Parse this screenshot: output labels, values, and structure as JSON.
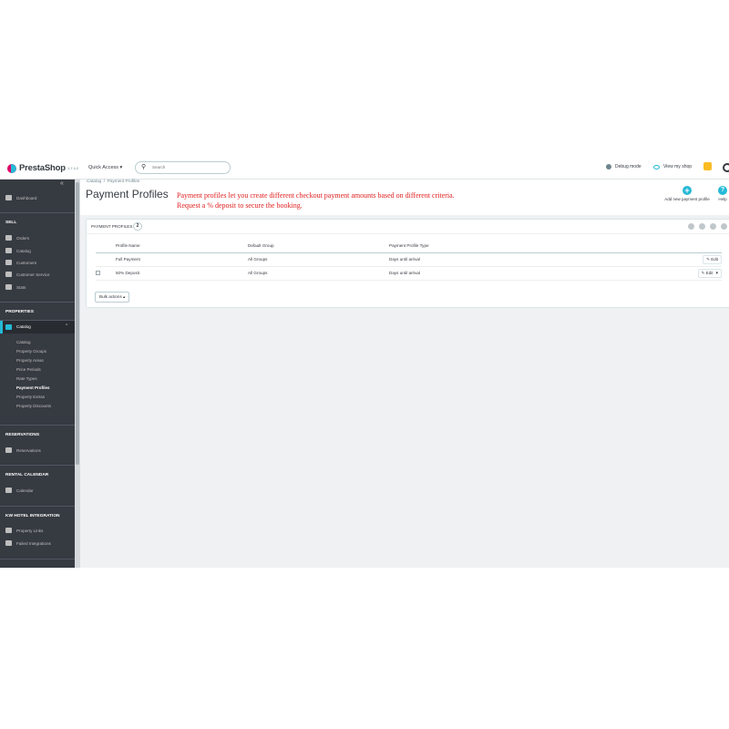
{
  "header": {
    "brand": "PrestaShop",
    "version": "1.7.4.2",
    "quick_access": "Quick Access ▾",
    "search_placeholder": "Search",
    "debug_mode": "Debug mode",
    "view_shop": "View my shop"
  },
  "sidebar": {
    "dashboard": "Dashboard",
    "sell_heading": "SELL",
    "sell_items": [
      "Orders",
      "Catalog",
      "Customers",
      "Customer Service",
      "Stats"
    ],
    "properties_heading": "PROPERTIES",
    "active_item": "Catalog",
    "sub_items": [
      "Catalog",
      "Property Groups",
      "Property Areas",
      "Price Periods",
      "Rate Types",
      "Payment Profiles",
      "Property Extras",
      "Property Discounts"
    ],
    "reservations_heading": "RESERVATIONS",
    "reservations_item": "Reservations",
    "calendar_heading": "RENTAL CALENDAR",
    "calendar_item": "Calendar",
    "kw_heading": "KW HOTEL INTEGRATION",
    "kw_items": [
      "Property Links",
      "Failed Integrations"
    ]
  },
  "page": {
    "breadcrumb_parent": "Catalog",
    "breadcrumb_current": "Payment Profiles",
    "title": "Payment Profiles",
    "hint_line1": "Payment profiles let you create different checkout payment amounts based on different criteria.",
    "hint_line2": "Request a % deposit to secure the booking.",
    "add_button": "Add new payment profile",
    "help_button": "Help"
  },
  "panel": {
    "title": "PAYMENT PROFILES",
    "count": "2",
    "columns": [
      "Profile Name",
      "Default Group",
      "Payment Profile Type"
    ],
    "rows": [
      {
        "name": "Full Payment",
        "group": "All Groups",
        "type": "Days until arrival",
        "action": "Edit"
      },
      {
        "name": "50% Deposit",
        "group": "All Groups",
        "type": "Days until arrival",
        "action": "Edit"
      }
    ],
    "bulk_actions": "Bulk actions ▴"
  },
  "colors": {
    "accent": "#25b9d7",
    "sidebar_bg": "#363a41",
    "hint_text": "#e02020",
    "brand_pink": "#df0067"
  }
}
